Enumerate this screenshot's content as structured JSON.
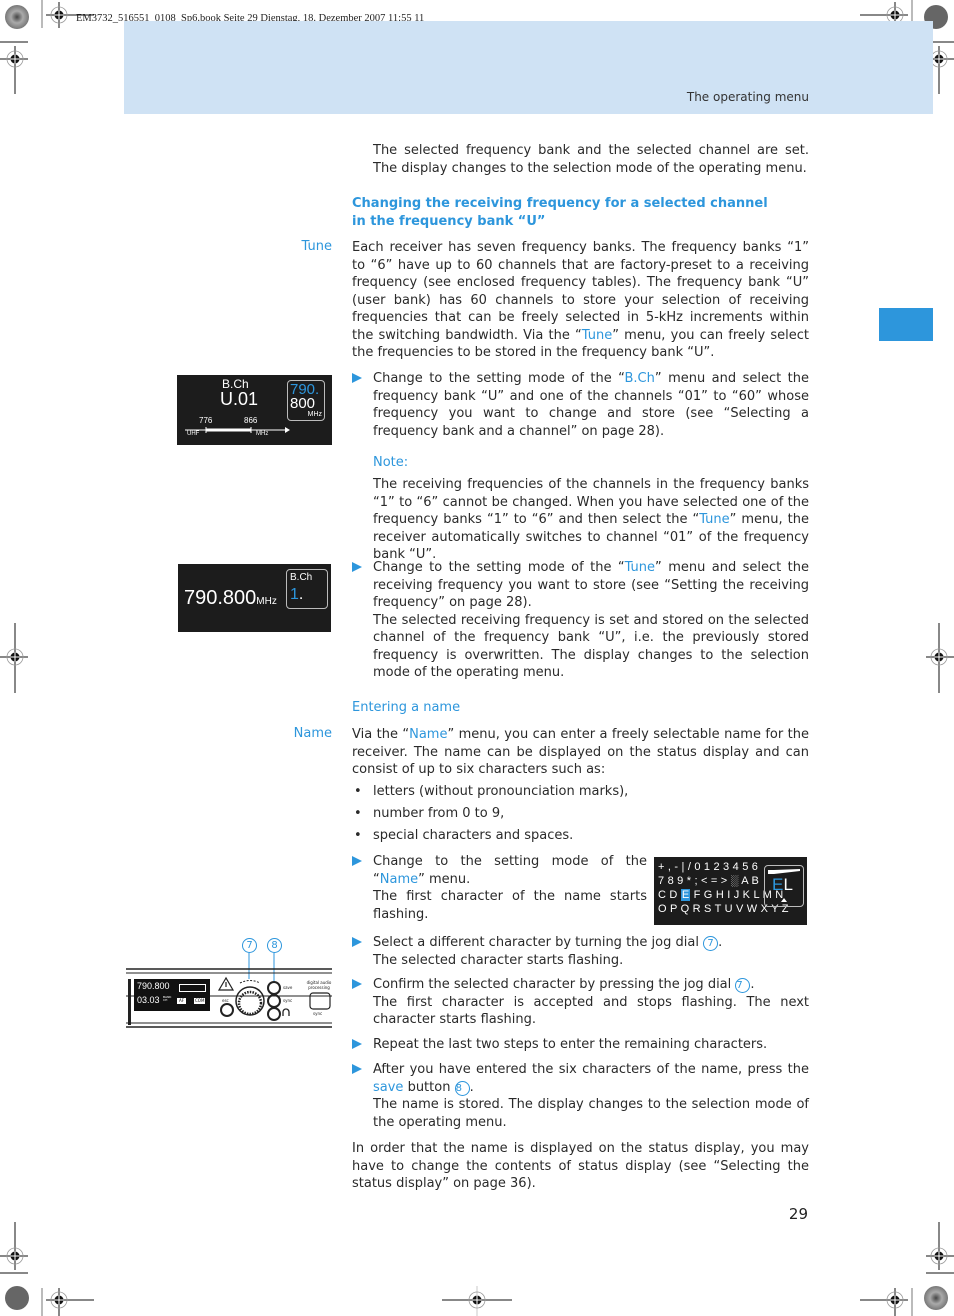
{
  "print_info": "EM3732_516551_0108_Sp6.book  Seite 29  Dienstag, 18. Dezember 2007  11:55 11",
  "header": {
    "section_title": "The operating menu"
  },
  "intro_paragraph": "The selected frequency bank and the selected channel are set. The display changes to the selection mode of the operating menu.",
  "section1": {
    "heading": "Changing the receiving frequency for a selected channel in the frequency bank “U”",
    "margin_label": "Tune",
    "paragraph": {
      "part1": "Each receiver has seven frequency banks. The frequency banks “1” to “6” have up to 60 channels that are factory-preset to a receiving frequency (see enclosed frequency tables). The frequency bank “U” (user bank) has 60 channels to store your selection of receiving frequencies that can be freely selected in 5-kHz increments within the switching bandwidth. Via the “",
      "link": "Tune",
      "part2": "” menu, you can freely select the frequencies to be stored in the frequency bank “U”."
    },
    "step1": {
      "part1": "Change to the setting mode of the “",
      "link": "B.Ch",
      "part2": "” menu and select the frequency bank “U” and one of the channels “01” to “60” whose frequency you want to change and store (see “Selecting a frequency bank and a channel” on page 28)."
    },
    "note": {
      "label": "Note:",
      "part1": "The receiving frequencies of the channels in the frequency banks “1” to “6” cannot be changed. When you have selected one of the frequency banks “1” to “6” and then select the “",
      "link": "Tune",
      "part2": "” menu, the receiver automatically switches to channel “01” of the frequency bank “U”."
    },
    "step2": {
      "part1": "Change to the setting mode of the “",
      "link": "Tune",
      "part2": "” menu and select the receiving frequency you want to store (see “Setting the receiving frequency” on page 28).",
      "result": "The selected receiving frequency is set and stored on the selected channel of the frequency bank “U”, i.e. the previously stored frequency is overwritten. The display changes to the selection mode of the operating menu."
    }
  },
  "display_bch": {
    "title": "B.Ch",
    "value": "U.01",
    "range_low": "776",
    "range_high": "866",
    "band_label": "UHF",
    "unit_label": "MHz",
    "box_line1": "790.",
    "box_line2": "800",
    "box_unit": "MHz"
  },
  "display_tune": {
    "frequency": "790.800",
    "unit": "MHz",
    "box_title": "B.Ch",
    "box_value": "1",
    "box_suffix": "."
  },
  "section2": {
    "heading": "Entering a name",
    "margin_label": "Name",
    "paragraph": {
      "part1": "Via the “",
      "link": "Name",
      "part2": "” menu, you can enter a freely selectable name for the receiver. The name can be displayed on the status display and can consist of up to six characters such as:"
    },
    "bullets": [
      "letters (without pronounciation marks),",
      "number from 0 to 9,",
      "special characters and spaces."
    ],
    "step1": {
      "part1": "Change to the setting mode of the “",
      "link": "Name",
      "part2": "” menu.",
      "result": "The first character of the name starts flashing."
    },
    "step2": {
      "part1": "Select a different character by turning the jog dial ",
      "ref": "7",
      "part2": ".",
      "result": "The selected character starts flashing."
    },
    "step3": {
      "part1": "Confirm the selected character by pressing the jog dial ",
      "ref": "7",
      "part2": ".",
      "result": "The first character is accepted and stops flashing. The next character starts flashing."
    },
    "step4": {
      "text": "Repeat the last two steps to enter the remaining characters."
    },
    "step5": {
      "part1": "After you have entered the six characters of the name, press the ",
      "link": "save",
      "part2": " button ",
      "ref": "8",
      "part3": ".",
      "result": "The name is stored. The display changes to the selection mode of the operating menu."
    },
    "closing": "In order that the name is displayed on the status display, you may have to change the contents of status display (see “Selecting the status display” on page 36)."
  },
  "display_name": {
    "rows": [
      "+ , - | / 0 1 2 3 4 5 6",
      "7 8 9 * ; < = > ░ A B",
      "C D",
      "O P Q R S T U V W X Y Z"
    ],
    "row3_selected": "E",
    "row3_rest": "F G H I J K L M N",
    "box_first": "E",
    "box_second": "L"
  },
  "device": {
    "callout_dial": "7",
    "callout_save": "8",
    "freq": "790.800",
    "bank_ch": "03.03",
    "bank_label": "BANK CH",
    "tag_af": "AF",
    "tag_com": "COM",
    "esc_label": "esc",
    "save_label": "save",
    "sync_label": "sync",
    "dap_label": "digital audio processing"
  },
  "page_number": "29",
  "colors": {
    "accent": "#2d96dc",
    "header_band": "#cfe2f4",
    "lcd_bg": "#1c1c1c"
  }
}
